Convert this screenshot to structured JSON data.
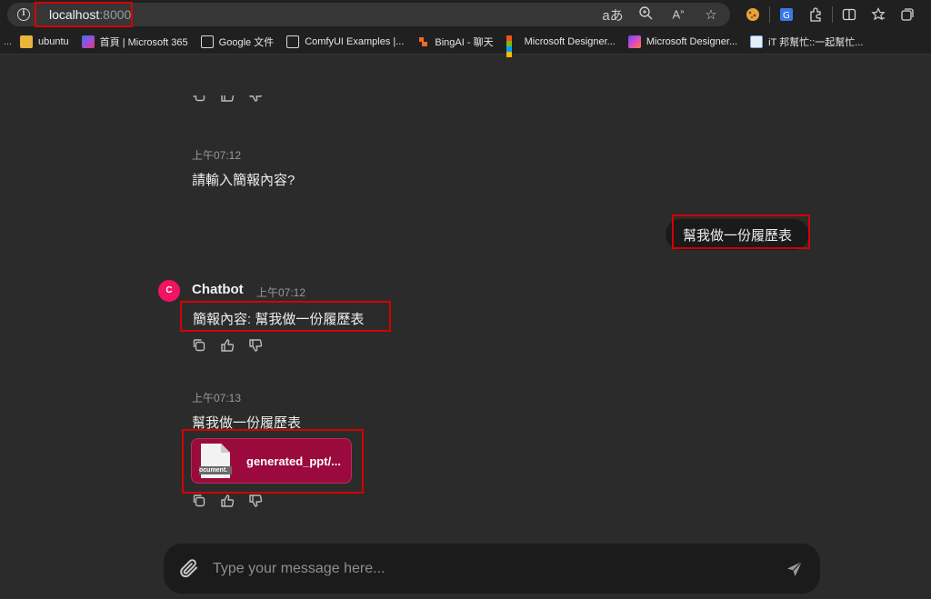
{
  "browser": {
    "url_host": "localhost",
    "url_port": ":8000",
    "bookmarks": [
      {
        "label": "ubuntu",
        "icon": "folder-icon"
      },
      {
        "label": "首頁 | Microsoft 365",
        "icon": "microsoft365-icon"
      },
      {
        "label": "Google 文件",
        "icon": "document-icon"
      },
      {
        "label": "ComfyUI Examples |...",
        "icon": "document-icon"
      },
      {
        "label": "BingAI - 聊天",
        "icon": "bing-icon"
      },
      {
        "label": "Microsoft Designer...",
        "icon": "microsoft-logo-icon"
      },
      {
        "label": "Microsoft Designer...",
        "icon": "designer-icon"
      },
      {
        "label": "iT 邦幫忙::一起幫忙...",
        "icon": "ithome-icon"
      }
    ],
    "overflow_label": "..."
  },
  "chat": {
    "messages": [
      {
        "time": "上午07:12",
        "text": "請輸入簡報內容?"
      },
      {
        "role": "user",
        "text": "幫我做一份履歷表"
      },
      {
        "author": "Chatbot",
        "avatar_letter": "C",
        "time": "上午07:12",
        "text": "簡報內容: 幫我做一份履歷表"
      },
      {
        "time": "上午07:13",
        "text": "幫我做一份履歷表",
        "file": {
          "name": "generated_ppt/...",
          "icon_label": "ocument."
        }
      }
    ]
  },
  "composer": {
    "placeholder": "Type your message here..."
  },
  "colors": {
    "background": "#2b2b2b",
    "avatar": "#f01462",
    "file_card": "#9b0a3c",
    "highlight": "#d40000"
  }
}
